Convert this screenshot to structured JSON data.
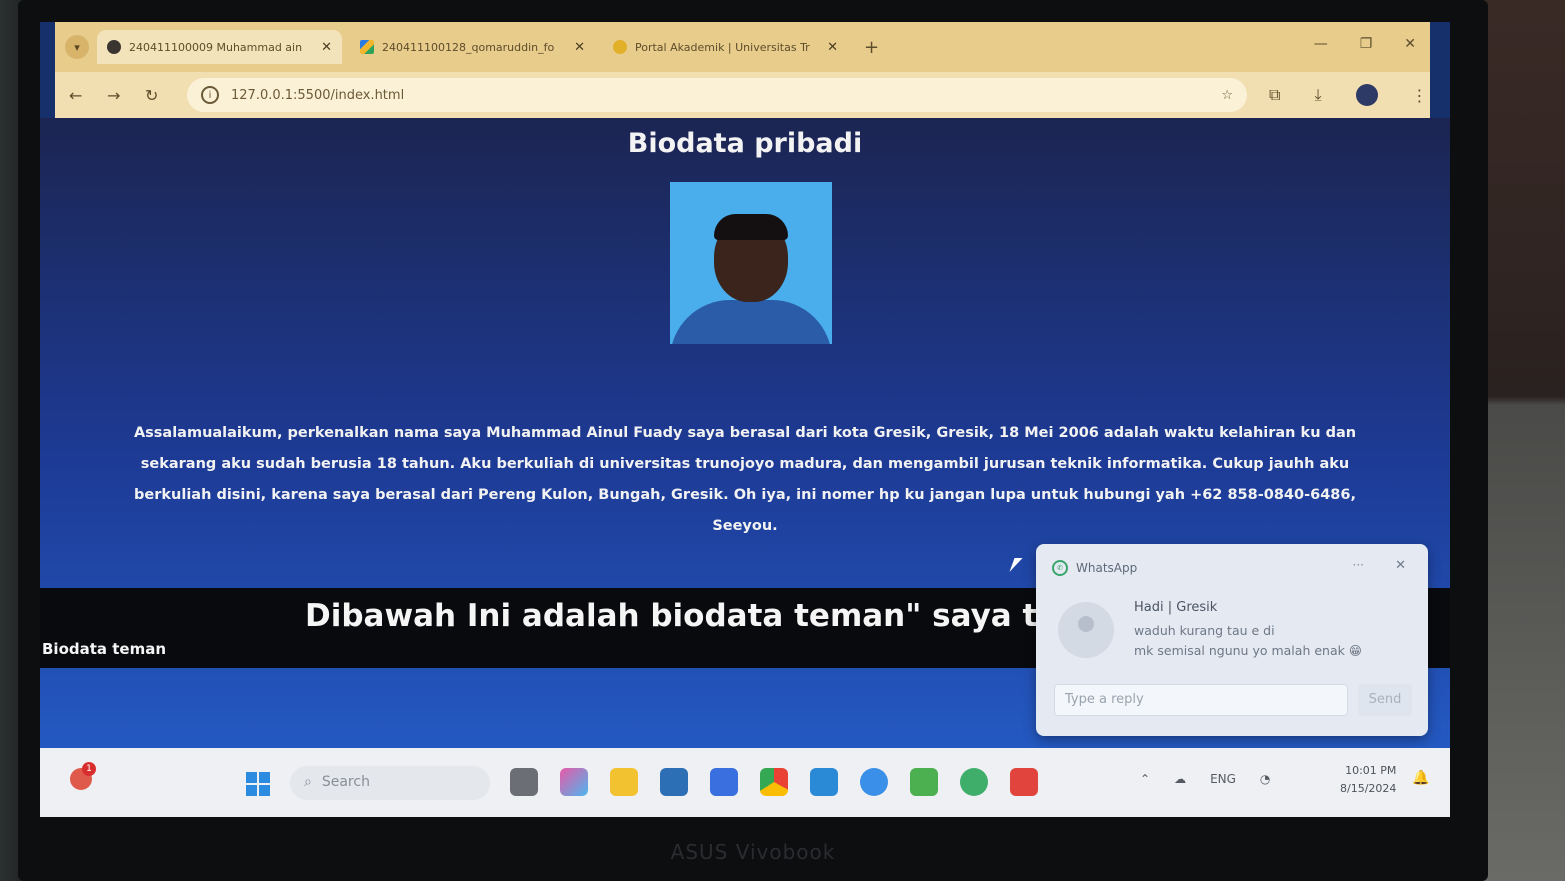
{
  "browser": {
    "tabs": [
      {
        "title": "240411100009 Muhammad ain",
        "active": true
      },
      {
        "title": "240411100128_qomaruddin_fo",
        "active": false
      },
      {
        "title": "Portal Akademik | Universitas Tr",
        "active": false
      }
    ],
    "url": "127.0.0.1:5500/index.html"
  },
  "page": {
    "title": "Biodata pribadi",
    "intro": "Assalamualaikum, perkenalkan nama saya Muhammad Ainul Fuady saya berasal dari kota Gresik, Gresik, 18 Mei 2006 adalah waktu kelahiran ku dan sekarang aku sudah berusia 18 tahun. Aku berkuliah di universitas trunojoyo madura, dan mengambil jurusan teknik informatika. Cukup jauhh aku berkuliah disini, karena saya berasal dari Pereng Kulon, Bungah, Gresik. Oh iya, ini nomer hp ku jangan lupa untuk hubungi yah +62 858-0840-6486, Seeyou.",
    "section_heading": "Dibawah Ini adalah biodata teman\" saya tolong",
    "section_sub": "Biodata teman"
  },
  "notification": {
    "app": "WhatsApp",
    "more": "···",
    "sender": "Hadi | Gresik",
    "message_line1": "waduh kurang tau e di",
    "message_line2": "mk semisal ngunu yo malah enak 😁",
    "reply_placeholder": "Type a reply",
    "send_label": "Send"
  },
  "taskbar": {
    "search_placeholder": "Search",
    "notification_badge": "1",
    "language": "ENG",
    "time": "10:01 PM",
    "date": "8/15/2024"
  },
  "device": {
    "brand": "ASUS Vivobook"
  },
  "colors": {
    "tabbar": "#e7cc8c",
    "page_bg": "#1d3b96",
    "band": "#090a0e",
    "toast": "#e4e9f2"
  }
}
